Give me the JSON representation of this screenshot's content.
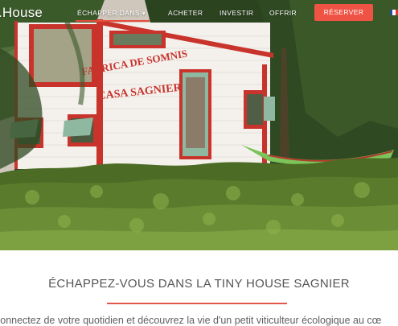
{
  "nav": {
    "brand": ".House",
    "items": [
      {
        "label": "ÉCHAPPER DANS",
        "has_dropdown": true,
        "active": true
      },
      {
        "label": "ACHETER"
      },
      {
        "label": "INVESTIR"
      },
      {
        "label": "OFFRIR"
      }
    ],
    "caret": "▾",
    "reserve_label": "RÉSERVER",
    "language": "french-flag-icon"
  },
  "hero": {
    "sign_line1": "FABRICA DE SOMNIS",
    "sign_line2": "CASA SAGNIER"
  },
  "intro": {
    "title": "ÉCHAPPEZ-VOUS DANS LA TINY HOUSE SAGNIER",
    "text": "connectez de votre quotidien et découvrez la vie d'un petit viticulteur écologique au cœ"
  },
  "colors": {
    "accent": "#ef5344",
    "trim_red": "#c8342c",
    "trim_green": "#8fb8a1",
    "house_white": "#f4f1ed",
    "hedge_green": "#4c6b24"
  }
}
